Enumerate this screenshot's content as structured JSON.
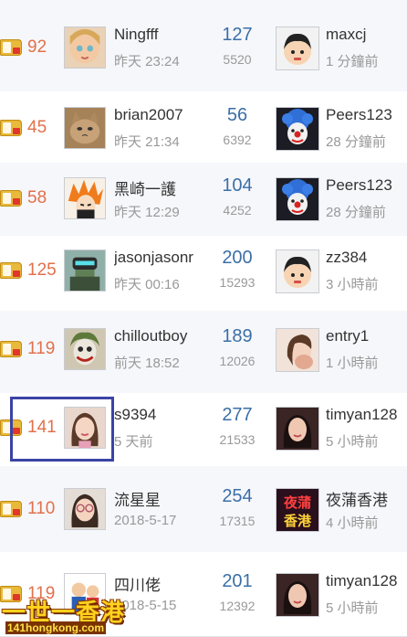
{
  "rows": [
    {
      "score": "92",
      "name": "Ningfff",
      "time": "昨天 23:24",
      "replies": "127",
      "views": "5520",
      "last_user": "maxcj",
      "last_time": "1 分鐘前"
    },
    {
      "score": "45",
      "name": "brian2007",
      "time": "昨天 21:34",
      "replies": "56",
      "views": "6392",
      "last_user": "Peers123",
      "last_time": "28 分鐘前"
    },
    {
      "score": "58",
      "name": "黑崎一護",
      "time": "昨天 12:29",
      "replies": "104",
      "views": "4252",
      "last_user": "Peers123",
      "last_time": "28 分鐘前"
    },
    {
      "score": "125",
      "name": "jasonjasonr",
      "time": "昨天 00:16",
      "replies": "200",
      "views": "15293",
      "last_user": "zz384",
      "last_time": "3 小時前"
    },
    {
      "score": "119",
      "name": "chilloutboy",
      "time": "前天 18:52",
      "replies": "189",
      "views": "12026",
      "last_user": "entry1",
      "last_time": "1 小時前"
    },
    {
      "score": "141",
      "name": "s9394",
      "time": "5 天前",
      "replies": "277",
      "views": "21533",
      "last_user": "timyan128",
      "last_time": "5 小時前"
    },
    {
      "score": "110",
      "name": "流星星",
      "time": "2018-5-17",
      "replies": "254",
      "views": "17315",
      "last_user": "夜蒲香港",
      "last_time": "4 小時前"
    },
    {
      "score": "119",
      "name": "四川佬",
      "time": "2018-5-15",
      "replies": "201",
      "views": "12392",
      "last_user": "timyan128",
      "last_time": "5 小時前"
    }
  ],
  "avatar_art": {
    "r4_last": "夜蒲 香港"
  },
  "watermark": {
    "title": "一世一香港",
    "url": "141hongkong.com"
  },
  "colors": {
    "score": "#e2704a",
    "replies": "#3b6fa6",
    "muted": "#999999",
    "highlight": "#3a44a4",
    "badge": "#e8b93a"
  },
  "icons": {
    "badge": "reward-badge-icon"
  }
}
